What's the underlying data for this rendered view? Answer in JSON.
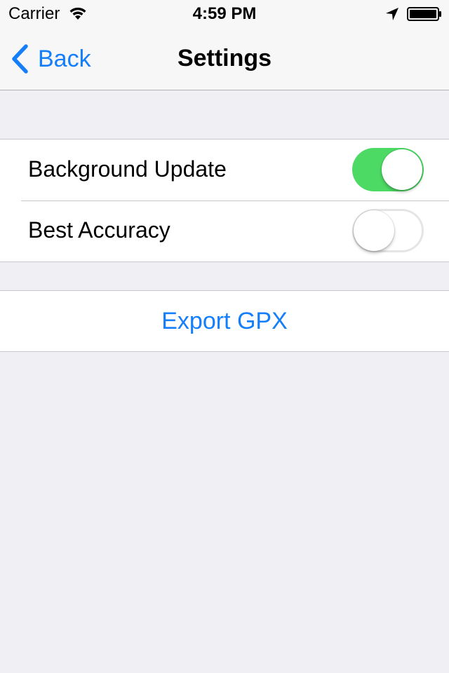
{
  "status_bar": {
    "carrier": "Carrier",
    "time": "4:59 PM",
    "icons": [
      "wifi-icon",
      "location-arrow-icon",
      "battery-icon"
    ]
  },
  "nav": {
    "back_label": "Back",
    "title": "Settings"
  },
  "settings": {
    "items": [
      {
        "label": "Background Update",
        "enabled": true
      },
      {
        "label": "Best Accuracy",
        "enabled": false
      }
    ]
  },
  "actions": {
    "export_label": "Export GPX"
  },
  "colors": {
    "accent": "#157efb",
    "switch_on": "#4cd964",
    "background": "#efeff4",
    "separator": "#c8c7cc"
  }
}
